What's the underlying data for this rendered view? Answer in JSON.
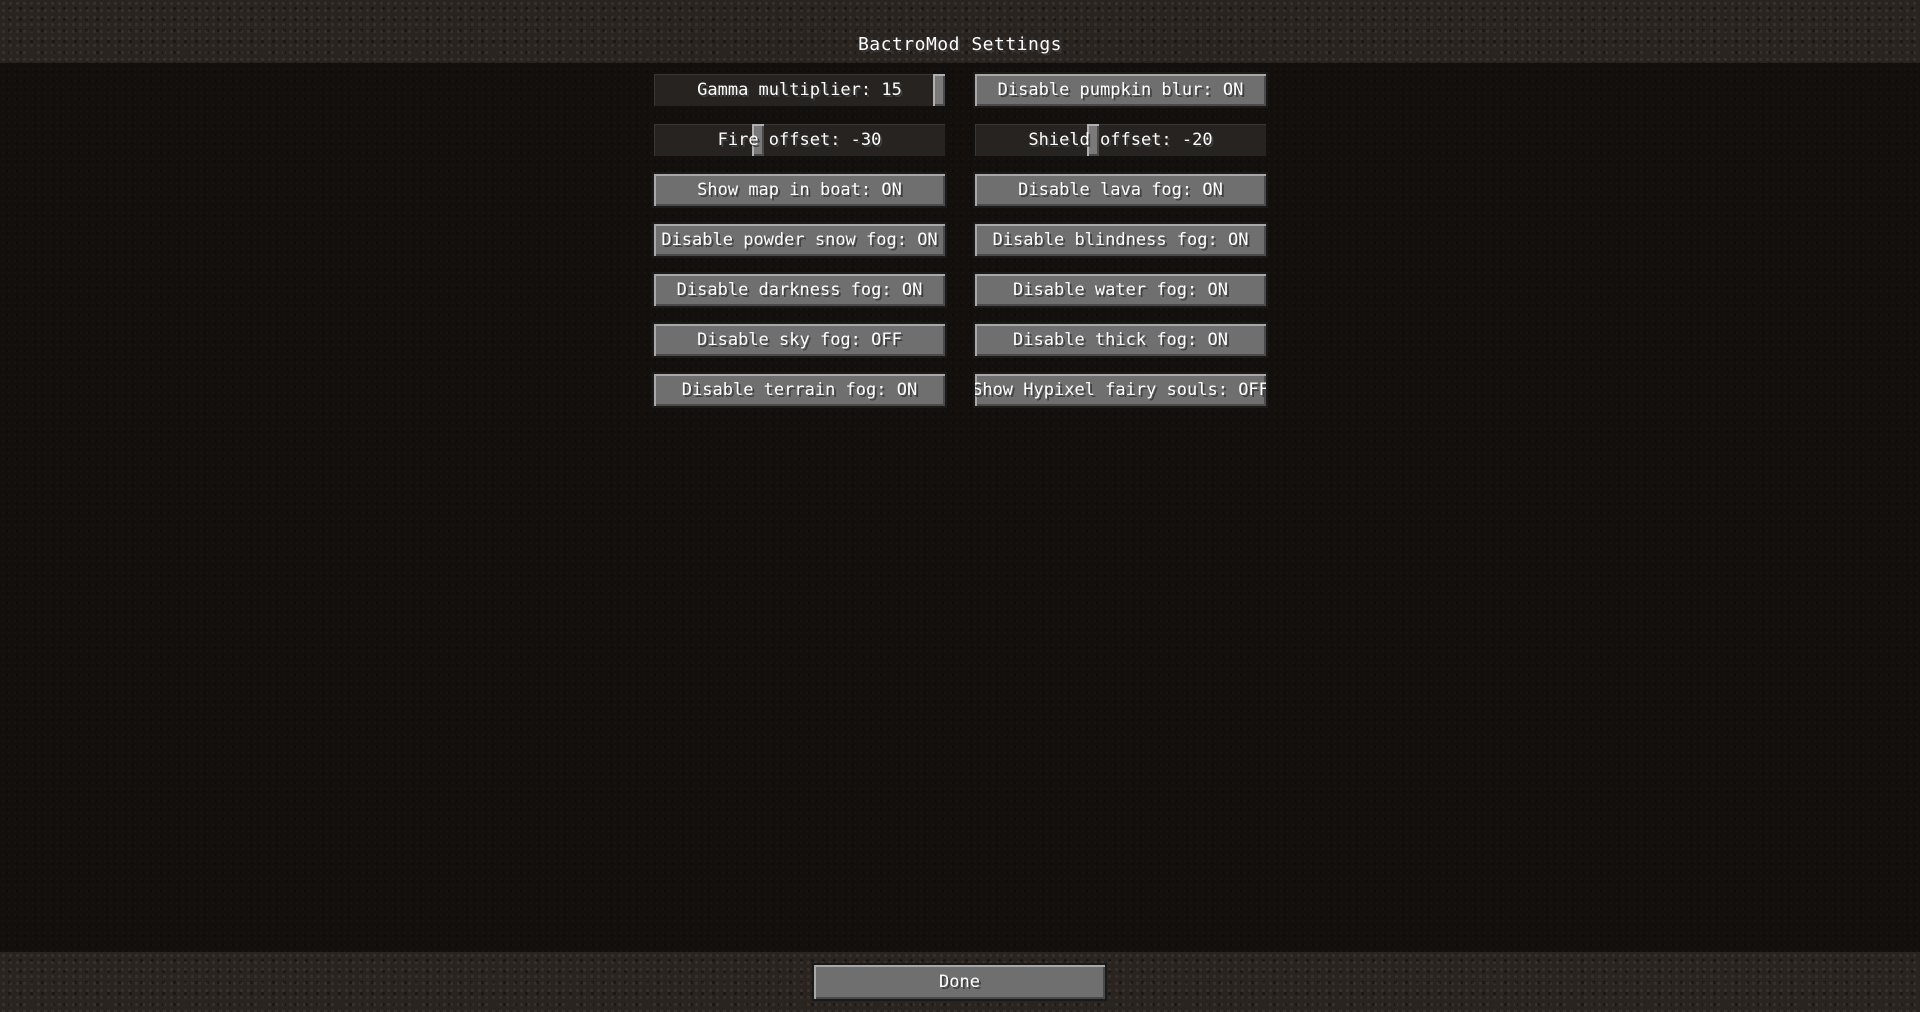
{
  "screen": {
    "title": "BactroMod Settings"
  },
  "options": {
    "gamma": {
      "label": "Gamma multiplier: 15",
      "level": 1.0
    },
    "pumpkin": {
      "label": "Disable pumpkin blur: ON"
    },
    "fire": {
      "label": "Fire offset: -30",
      "level": 0.35
    },
    "shield": {
      "label": "Shield offset: -20",
      "level": 0.4
    },
    "map_boat": {
      "label": "Show map in boat: ON"
    },
    "lava_fog": {
      "label": "Disable lava fog: ON"
    },
    "powder_snow_fog": {
      "label": "Disable powder snow fog: ON"
    },
    "blindness_fog": {
      "label": "Disable blindness fog: ON"
    },
    "darkness_fog": {
      "label": "Disable darkness fog: ON"
    },
    "water_fog": {
      "label": "Disable water fog: ON"
    },
    "sky_fog": {
      "label": "Disable sky fog: OFF"
    },
    "thick_fog": {
      "label": "Disable thick fog: ON"
    },
    "terrain_fog": {
      "label": "Disable terrain fog: ON"
    },
    "fairy_souls": {
      "label": "Show Hypixel fairy souls: OFF"
    }
  },
  "footer": {
    "done_label": "Done"
  }
}
